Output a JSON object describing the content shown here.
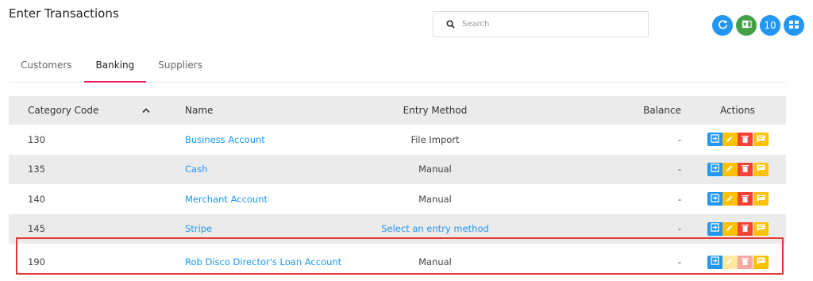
{
  "page": {
    "title": "Enter Transactions"
  },
  "search": {
    "placeholder": "Search"
  },
  "top_actions": [
    {
      "icon": "refresh-icon",
      "color": "#2196f3"
    },
    {
      "icon": "excel-icon",
      "color": "#43a047"
    },
    {
      "label": "10",
      "color": "#2196f3"
    },
    {
      "icon": "grid-icon",
      "color": "#2196f3"
    }
  ],
  "tabs": [
    {
      "label": "Customers",
      "active": false
    },
    {
      "label": "Banking",
      "active": true
    },
    {
      "label": "Suppliers",
      "active": false
    }
  ],
  "table": {
    "headers": {
      "code": "Category Code",
      "name": "Name",
      "entry": "Entry Method",
      "balance": "Balance",
      "actions": "Actions"
    },
    "sort_icon": "chevron-up-icon",
    "rows": [
      {
        "code": "130",
        "name": "Business Account",
        "entry": "File Import",
        "balance": "-"
      },
      {
        "code": "135",
        "name": "Cash",
        "entry": "Manual",
        "balance": "-"
      },
      {
        "code": "140",
        "name": "Merchant Account",
        "entry": "Manual",
        "balance": "-"
      },
      {
        "code": "145",
        "name": "Stripe",
        "entry": "Select an entry method",
        "balance": "-"
      },
      {
        "code": "190",
        "name": "Rob Disco Director's Loan Account",
        "entry": "Manual",
        "balance": "-"
      }
    ]
  },
  "colors": {
    "accent": "#e91e63",
    "link": "#2196f3",
    "action_blue": "#2196f3",
    "action_yellow": "#ffc107",
    "action_red": "#f44336",
    "highlight": "#e53935"
  }
}
